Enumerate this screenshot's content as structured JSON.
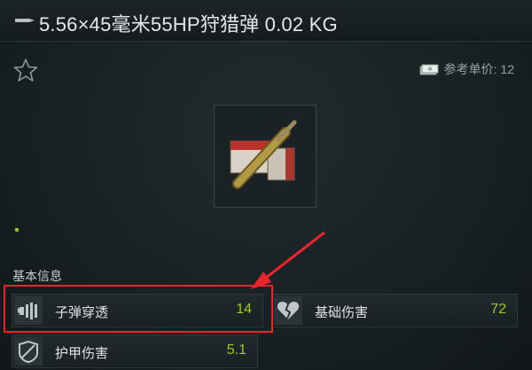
{
  "title": "5.56×45毫米55HP狩猎弹 0.02 KG",
  "price": {
    "label": "参考单价:",
    "value": "12"
  },
  "section_label": "基本信息",
  "stats": [
    {
      "label": "子弹穿透",
      "value": "14",
      "icon": "bullet-penetration-icon"
    },
    {
      "label": "基础伤害",
      "value": "72",
      "icon": "broken-heart-icon"
    },
    {
      "label": "护甲伤害",
      "value": "5.1",
      "icon": "armor-damage-icon"
    }
  ],
  "colors": {
    "value": "#9ccc21",
    "highlight": "#e8262a",
    "background": "#141a1c"
  }
}
